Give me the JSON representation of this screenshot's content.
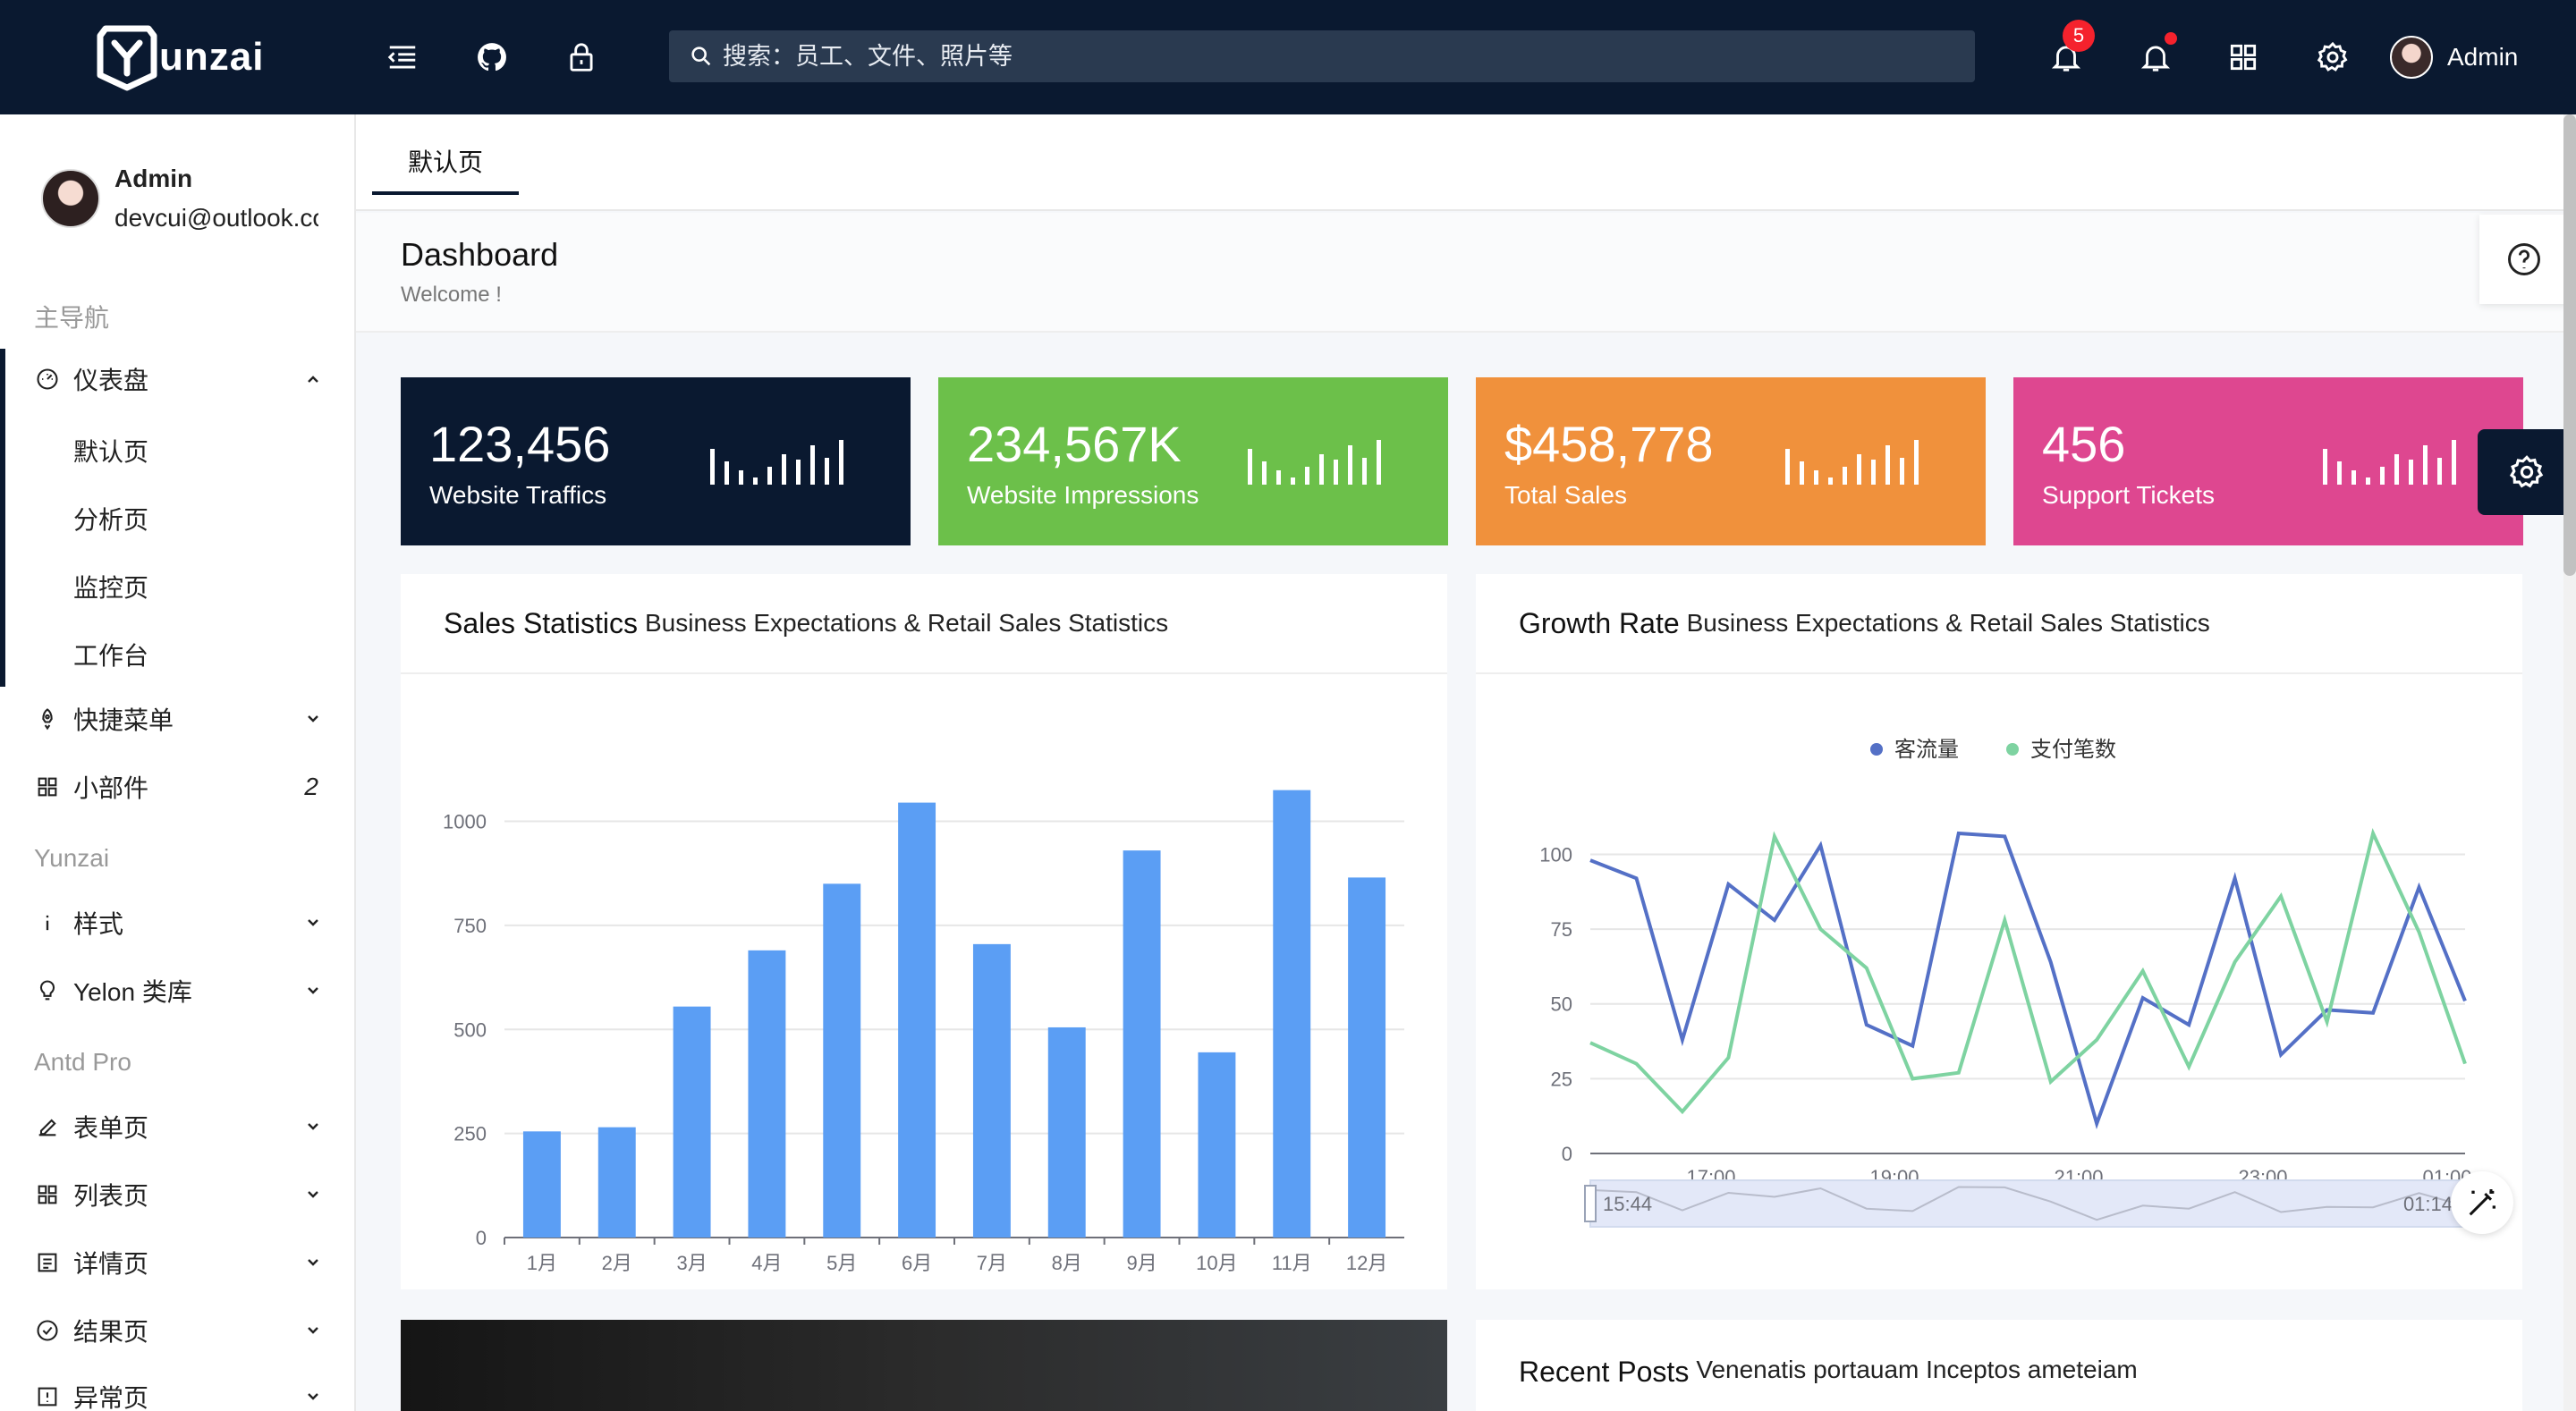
{
  "header": {
    "logo_text": "unzai",
    "search_placeholder": "搜索：员工、文件、照片等",
    "notification_count": "5",
    "user_name": "Admin"
  },
  "sidebar": {
    "user_name": "Admin",
    "user_email": "devcui@outlook.com",
    "groups": [
      "主导航",
      "Yunzai",
      "Antd Pro"
    ],
    "dashboard": {
      "label": "仪表盘",
      "children": [
        "默认页",
        "分析页",
        "监控页",
        "工作台"
      ]
    },
    "shortcut": "快捷菜单",
    "widgets": {
      "label": "小部件",
      "count": "2"
    },
    "style": "样式",
    "yelon": "Yelon 类库",
    "form": "表单页",
    "list": "列表页",
    "detail": "详情页",
    "result": "结果页",
    "exception": "异常页"
  },
  "tabs": [
    {
      "label": "默认页"
    }
  ],
  "page": {
    "title": "Dashboard",
    "subtitle": "Welcome !"
  },
  "stats": [
    {
      "value": "123,456",
      "label": "Website Traffics",
      "color": "#0a1930"
    },
    {
      "value": "234,567K",
      "label": "Website Impressions",
      "color": "#6cc04a"
    },
    {
      "value": "$458,778",
      "label": "Total Sales",
      "color": "#f0913c"
    },
    {
      "value": "456",
      "label": "Support Tickets",
      "color": "#de4790"
    }
  ],
  "sales_panel": {
    "title": "Sales Statistics",
    "subtitle": "Business Expectations & Retail Sales Statistics"
  },
  "growth_panel": {
    "title": "Growth Rate",
    "subtitle": "Business Expectations & Retail Sales Statistics"
  },
  "posts_panel": {
    "title": "Recent Posts",
    "subtitle": "Venenatis portauam Inceptos ameteiam"
  },
  "chart_data": [
    {
      "type": "bar",
      "categories": [
        "1月",
        "2月",
        "3月",
        "4月",
        "5月",
        "6月",
        "7月",
        "8月",
        "9月",
        "10月",
        "11月",
        "12月"
      ],
      "values": [
        255,
        265,
        555,
        690,
        850,
        1045,
        705,
        505,
        930,
        445,
        1075,
        865
      ],
      "ylim": [
        0,
        1100
      ],
      "yticks": [
        0,
        250,
        500,
        750,
        1000
      ],
      "color": "#5b9ef4"
    },
    {
      "type": "line",
      "x": [
        "15:44",
        "16:20",
        "16:56",
        "17:32",
        "18:08",
        "18:44",
        "19:20",
        "19:56",
        "20:32",
        "21:08",
        "21:44",
        "22:20",
        "22:56",
        "23:32",
        "00:08",
        "00:44",
        "01:14"
      ],
      "xticks": [
        "17:00",
        "19:00",
        "21:00",
        "23:00",
        "01:00"
      ],
      "series": [
        {
          "name": "客流量",
          "color": "#5470c6",
          "values": [
            98,
            92,
            38,
            90,
            78,
            103,
            43,
            36,
            107,
            106,
            64,
            10,
            52,
            43,
            92,
            33,
            48,
            47,
            89,
            51
          ]
        },
        {
          "name": "支付笔数",
          "color": "#7ed3a1",
          "values": [
            37,
            30,
            14,
            32,
            106,
            75,
            62,
            25,
            27,
            78,
            24,
            38,
            61,
            29,
            64,
            86,
            44,
            107,
            74,
            30
          ]
        }
      ],
      "ylim": [
        0,
        110
      ],
      "yticks": [
        0,
        25,
        50,
        75,
        100
      ],
      "dataZoom": {
        "start_label": "15:44",
        "end_label": "01:14"
      }
    }
  ]
}
